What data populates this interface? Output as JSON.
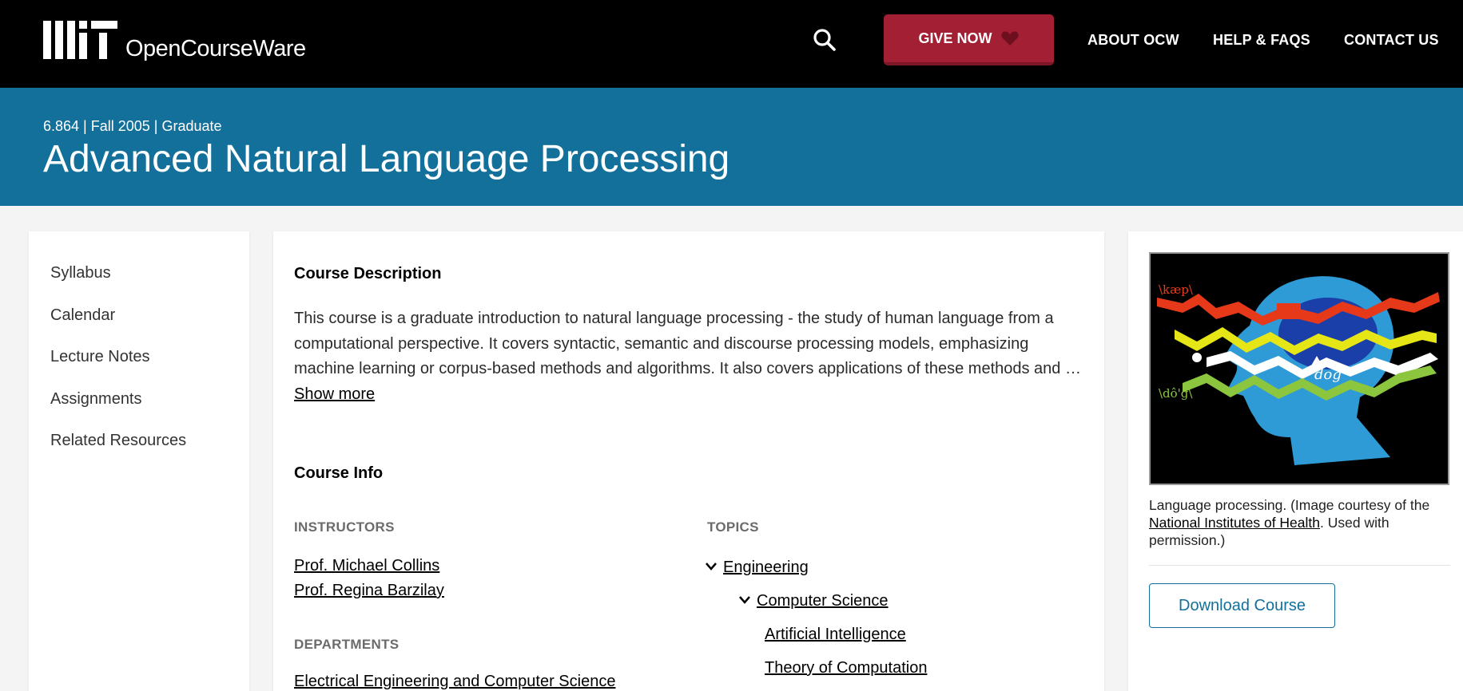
{
  "header": {
    "logo_text": "OpenCourseWare",
    "give_now_label": "GIVE NOW",
    "nav": [
      "ABOUT OCW",
      "HELP & FAQS",
      "CONTACT US"
    ]
  },
  "banner": {
    "meta": "6.864 | Fall 2005 | Graduate",
    "title": "Advanced Natural Language Processing"
  },
  "sidebar": {
    "items": [
      "Syllabus",
      "Calendar",
      "Lecture Notes",
      "Assignments",
      "Related Resources"
    ]
  },
  "main": {
    "description_heading": "Course Description",
    "description_text": "This course is a graduate introduction to natural language processing - the study of human language from a computational perspective. It covers syntactic, semantic and discourse processing models, emphasizing machine learning or corpus-based methods and algorithms. It also covers applications of these methods and …",
    "show_more": "Show more",
    "info_heading": "Course Info",
    "instructors_label": "INSTRUCTORS",
    "instructors": [
      "Prof. Michael Collins",
      "Prof. Regina Barzilay"
    ],
    "departments_label": "DEPARTMENTS",
    "departments": [
      "Electrical Engineering and Computer Science"
    ],
    "topics_label": "TOPICS",
    "topics": {
      "level1": "Engineering",
      "level2": "Computer Science",
      "level3": [
        "Artificial Intelligence",
        "Theory of Computation"
      ]
    }
  },
  "right": {
    "image_text": {
      "top": "\\kæp\\",
      "bottom": "\\dô'g\\",
      "center": "dog"
    },
    "caption_before": "Language processing. (Image courtesy of the ",
    "caption_link": "National Institutes of Health",
    "caption_after": ". Used with permission.)",
    "download_label": "Download Course"
  },
  "colors": {
    "banner": "#12709b",
    "give_button": "#a31f34",
    "topbar": "#000000"
  }
}
